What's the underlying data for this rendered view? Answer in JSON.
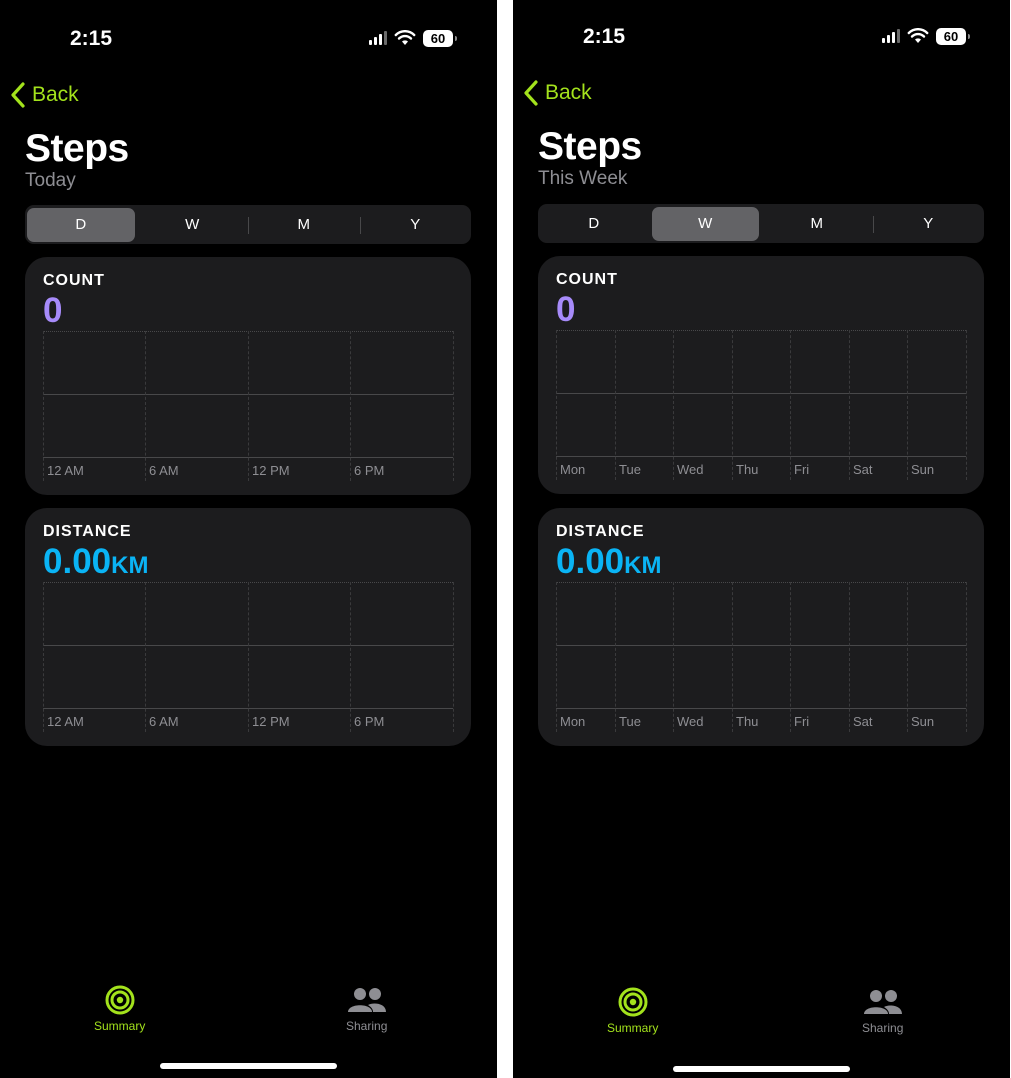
{
  "colors": {
    "accent": "#a3e21c",
    "count": "#a78bfa",
    "distance": "#0ab4f5"
  },
  "screens": [
    {
      "status": {
        "time": "2:15",
        "battery": "60"
      },
      "back_label": "Back",
      "title": "Steps",
      "subtitle": "Today",
      "segments": [
        "D",
        "W",
        "M",
        "Y"
      ],
      "selected_segment": "D",
      "count": {
        "label": "COUNT",
        "value": "0"
      },
      "distance": {
        "label": "DISTANCE",
        "value": "0.00",
        "unit": "KM"
      },
      "x_ticks": [
        "12 AM",
        "6 AM",
        "12 PM",
        "6 PM"
      ],
      "tabs": [
        {
          "label": "Summary",
          "icon": "activity-rings-icon"
        },
        {
          "label": "Sharing",
          "icon": "people-icon"
        }
      ]
    },
    {
      "status": {
        "time": "2:15",
        "battery": "60"
      },
      "back_label": "Back",
      "title": "Steps",
      "subtitle": "This Week",
      "segments": [
        "D",
        "W",
        "M",
        "Y"
      ],
      "selected_segment": "W",
      "count": {
        "label": "COUNT",
        "value": "0"
      },
      "distance": {
        "label": "DISTANCE",
        "value": "0.00",
        "unit": "KM"
      },
      "x_ticks": [
        "Mon",
        "Tue",
        "Wed",
        "Thu",
        "Fri",
        "Sat",
        "Sun"
      ],
      "tabs": [
        {
          "label": "Summary",
          "icon": "activity-rings-icon"
        },
        {
          "label": "Sharing",
          "icon": "people-icon"
        }
      ]
    }
  ]
}
